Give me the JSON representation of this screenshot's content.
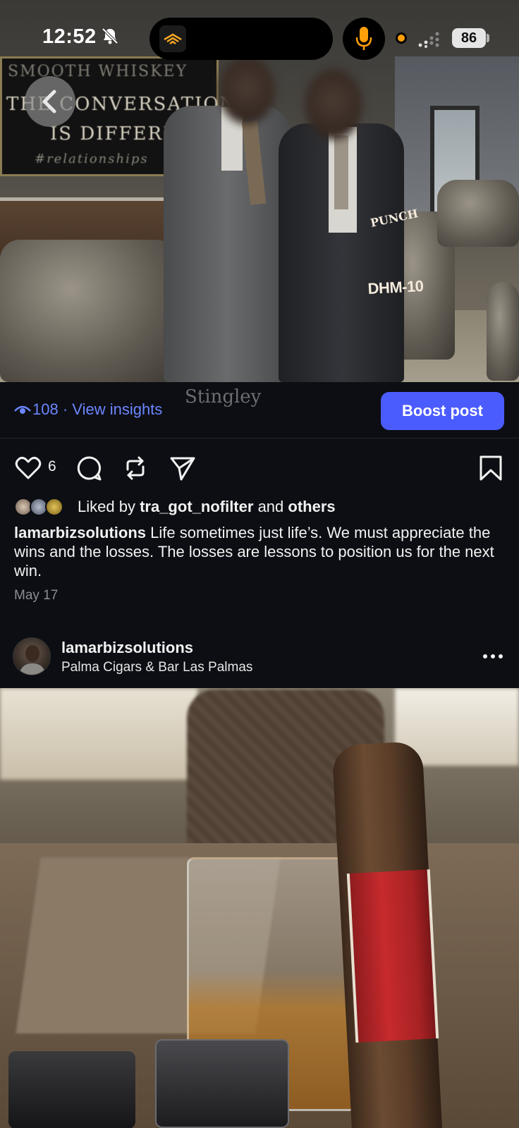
{
  "status_bar": {
    "time": "12:52",
    "battery": "86"
  },
  "post1": {
    "photo_sign_lines": [
      "SMOOTH WHISKEY",
      "THE CONVERSATION",
      "IS DIFFERENT",
      "#relationships"
    ],
    "views": "108",
    "insights_link": "View insights",
    "separator": "·",
    "boost_label": "Boost post",
    "like_count": "6",
    "liked_by_prefix": "Liked by",
    "liked_by_user": "tra_got_nofilter",
    "liked_by_and": "and",
    "liked_by_others": "others",
    "caption_user": "lamarbizsolutions",
    "caption_text": "Life sometimes just life’s. We must appreciate the wins and the losses. The losses are lessons to position us for the next win.",
    "date": "May 17"
  },
  "post2": {
    "username": "lamarbizsolutions",
    "location": "Palma Cigars & Bar Las Palmas",
    "band_brand": "PUNCH",
    "band_model": "DHM-10",
    "lighter_brand": "Stingley"
  },
  "colors": {
    "background": "#0c0e13",
    "link_blue": "#6d86ff",
    "boost_button": "#4b5cff",
    "muted_text": "#8b8e96"
  },
  "icons": [
    "bell-off-icon",
    "audible-icon",
    "mic-icon",
    "signal-icon",
    "back-icon",
    "eye-icon",
    "heart-icon",
    "comment-icon",
    "repost-icon",
    "share-icon",
    "bookmark-icon",
    "more-icon"
  ]
}
